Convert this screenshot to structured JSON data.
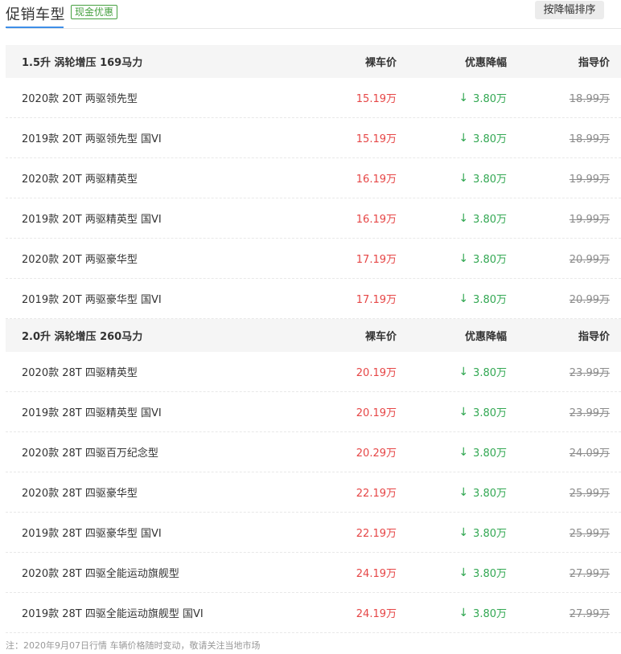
{
  "header": {
    "title": "促销车型",
    "badge": "现金优惠",
    "sort_button": "按降幅排序"
  },
  "colors": {
    "accent": "#3e8ee8",
    "price_red": "#e64646",
    "discount_green": "#33a853",
    "badge_green": "#46a040",
    "strike_gray": "#8c8c8c"
  },
  "groups": [
    {
      "title": "1.5升 涡轮增压 169马力",
      "col_price": "裸车价",
      "col_discount": "优惠降幅",
      "col_guide": "指导价",
      "rows": [
        {
          "name": "2020款 20T 两驱领先型",
          "price": "15.19万",
          "discount": "3.80万",
          "guide": "18.99万"
        },
        {
          "name": "2019款 20T 两驱领先型 国VI",
          "price": "15.19万",
          "discount": "3.80万",
          "guide": "18.99万"
        },
        {
          "name": "2020款 20T 两驱精英型",
          "price": "16.19万",
          "discount": "3.80万",
          "guide": "19.99万"
        },
        {
          "name": "2019款 20T 两驱精英型 国VI",
          "price": "16.19万",
          "discount": "3.80万",
          "guide": "19.99万"
        },
        {
          "name": "2020款 20T 两驱豪华型",
          "price": "17.19万",
          "discount": "3.80万",
          "guide": "20.99万"
        },
        {
          "name": "2019款 20T 两驱豪华型 国VI",
          "price": "17.19万",
          "discount": "3.80万",
          "guide": "20.99万"
        }
      ]
    },
    {
      "title": "2.0升 涡轮增压 260马力",
      "col_price": "裸车价",
      "col_discount": "优惠降幅",
      "col_guide": "指导价",
      "rows": [
        {
          "name": "2020款 28T 四驱精英型",
          "price": "20.19万",
          "discount": "3.80万",
          "guide": "23.99万"
        },
        {
          "name": "2019款 28T 四驱精英型 国VI",
          "price": "20.19万",
          "discount": "3.80万",
          "guide": "23.99万"
        },
        {
          "name": "2020款 28T 四驱百万纪念型",
          "price": "20.29万",
          "discount": "3.80万",
          "guide": "24.09万"
        },
        {
          "name": "2020款 28T 四驱豪华型",
          "price": "22.19万",
          "discount": "3.80万",
          "guide": "25.99万"
        },
        {
          "name": "2019款 28T 四驱豪华型 国VI",
          "price": "22.19万",
          "discount": "3.80万",
          "guide": "25.99万"
        },
        {
          "name": "2020款 28T 四驱全能运动旗舰型",
          "price": "24.19万",
          "discount": "3.80万",
          "guide": "27.99万"
        },
        {
          "name": "2019款 28T 四驱全能运动旗舰型 国VI",
          "price": "24.19万",
          "discount": "3.80万",
          "guide": "27.99万"
        }
      ]
    }
  ],
  "icons": {
    "discount_arrow": "down-arrow-icon",
    "arrow_glyph": "↓"
  },
  "footnote": "注：2020年9月07日行情 车辆价格随时变动，敬请关注当地市场"
}
